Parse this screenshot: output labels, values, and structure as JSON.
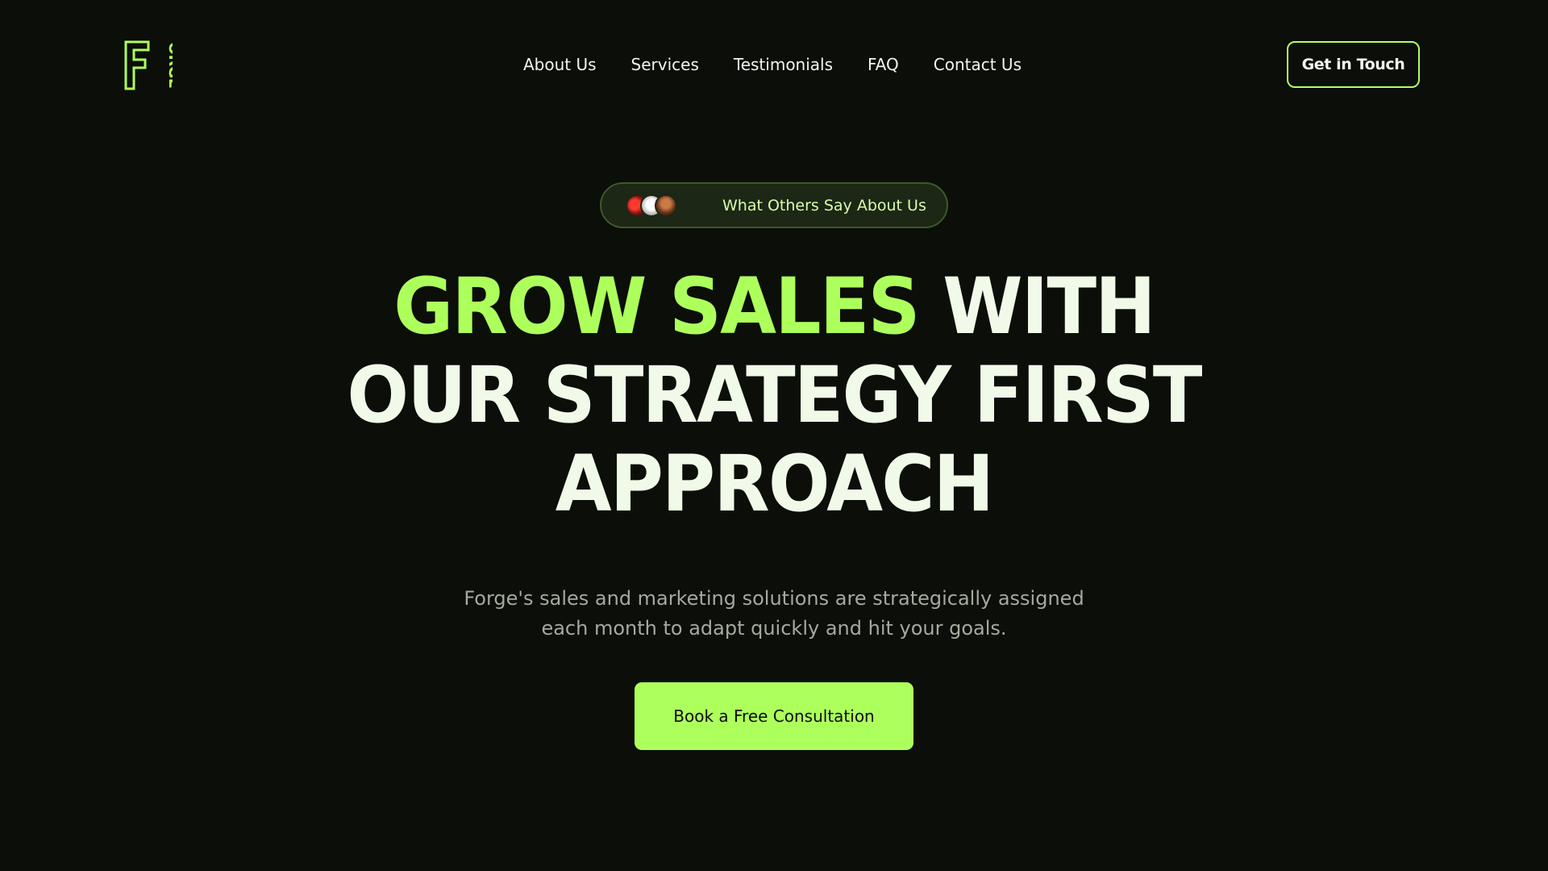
{
  "brand": {
    "logo_text": "FORGE",
    "accent_color": "#adff5c",
    "background_color": "#0b0e09",
    "text_color": "#f1fae8"
  },
  "nav": {
    "items": [
      {
        "label": "About Us"
      },
      {
        "label": "Services"
      },
      {
        "label": "Testimonials"
      },
      {
        "label": "FAQ"
      },
      {
        "label": "Contact Us"
      }
    ],
    "cta_label": "Get in Touch"
  },
  "hero": {
    "pill": {
      "avatars": [
        "avatar-red",
        "avatar-white",
        "avatar-portrait"
      ],
      "label": "What Others Say About Us"
    },
    "headline": {
      "line1_accent": "GROW SALES",
      "line1_rest": "WITH",
      "line2": "OUR STRATEGY FIRST",
      "line3": "APPROACH"
    },
    "subtitle": {
      "line1": "Forge's sales and marketing solutions are strategically assigned",
      "line2": "each month to adapt quickly and hit your goals."
    },
    "cta_label": "Book a Free Consultation"
  }
}
